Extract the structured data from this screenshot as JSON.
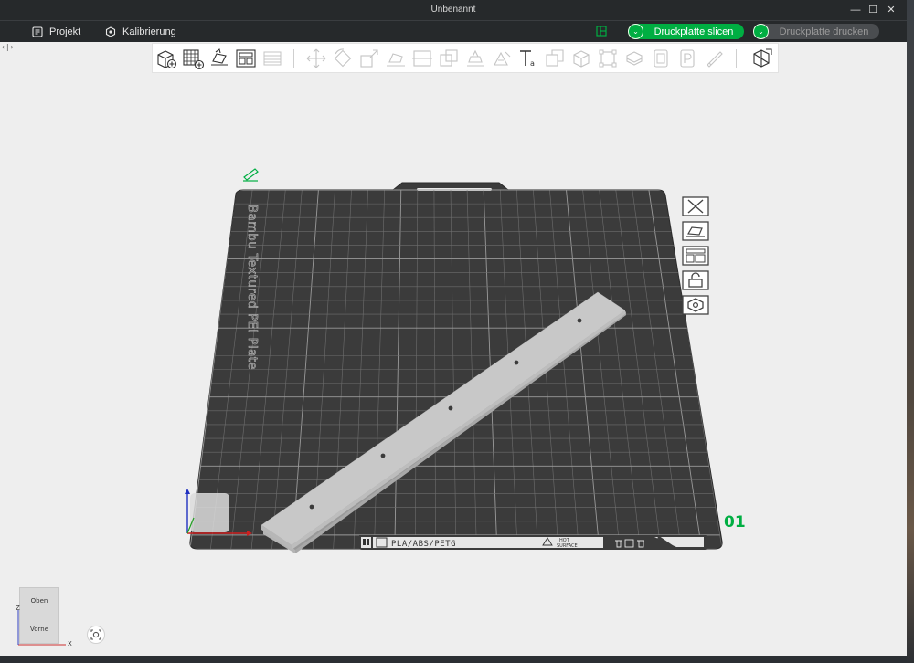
{
  "window": {
    "title": "Unbenannt",
    "controls": {
      "minimize": "—",
      "maximize": "☐",
      "close": "✕"
    }
  },
  "menubar": {
    "project": "Projekt",
    "calibration": "Kalibrierung",
    "slice_button": "Druckplatte slicen",
    "print_button": "Druckplatte drucken",
    "dropdown_glyph": "⌄"
  },
  "sidebar": {
    "toggle": "‹|›"
  },
  "toolbar": {
    "groups": [
      [
        "add-icon",
        "add-plate-icon",
        "auto-orient-icon",
        "arrange-icon",
        "split-icon"
      ],
      [
        "move-icon",
        "rotate-icon",
        "scale-icon",
        "lay-on-face-icon",
        "cut-icon",
        "boolean-icon",
        "support-paint-icon",
        "seam-paint-icon",
        "text-icon",
        "mesh-boolean-icon",
        "measure-icon",
        "assemble-icon",
        "brim-ears-icon",
        "variable-layer-icon",
        "layers-icon",
        "color-paint-icon",
        "pen-icon"
      ],
      [
        "view-toggle-icon"
      ]
    ]
  },
  "plate": {
    "label": "Bambu Textured PEI Plate",
    "material_label": "PLA/ABS/PETG",
    "hot_surface": [
      "HOT",
      "SURFACE"
    ],
    "plate_number": "01"
  },
  "plate_tools": [
    "close-plate-icon",
    "auto-orient-plate-icon",
    "arrange-plate-icon",
    "lock-plate-icon",
    "plate-settings-icon"
  ],
  "view_cube": {
    "top": "Oben",
    "front": "Vorne",
    "x_axis": "X",
    "z_axis": "Z"
  },
  "colors": {
    "accent": "#00ae42",
    "titlebar": "#26292b",
    "plate": "#3b3b3b",
    "grid": "#8a8a8a",
    "object": "#c8c8c8"
  }
}
